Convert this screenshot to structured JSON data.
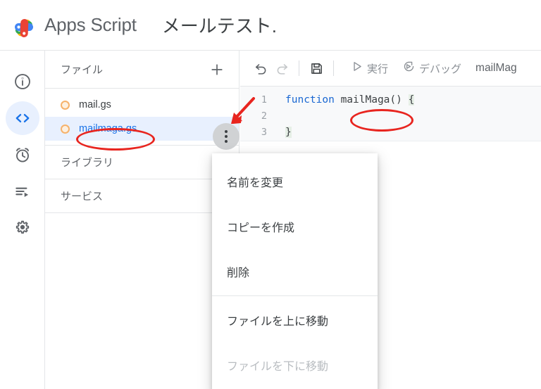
{
  "header": {
    "logo_icon": "apps-script-logo",
    "brand": "Apps Script",
    "project_title": "メールテスト.",
    "logo_colors": {
      "yellow": "#fbbc04",
      "green": "#34a853",
      "blue": "#4285f4",
      "red": "#ea4335"
    }
  },
  "rail": {
    "items": [
      {
        "icon": "info-circle-icon",
        "name": "overview",
        "active": false
      },
      {
        "icon": "code-brackets-icon",
        "name": "editor",
        "active": true
      },
      {
        "icon": "alarm-clock-icon",
        "name": "triggers",
        "active": false
      },
      {
        "icon": "executions-list-icon",
        "name": "executions",
        "active": false
      },
      {
        "icon": "gear-icon",
        "name": "project-settings",
        "active": false
      }
    ],
    "active_bg": "#e8f0fe",
    "active_color": "#1a73e8"
  },
  "file_panel": {
    "header_label": "ファイル",
    "add_icon": "plus-icon",
    "files": [
      {
        "name": "mail.gs",
        "selected": false,
        "dot_color": "#f6b26b"
      },
      {
        "name": "mailmaga.gs",
        "selected": true,
        "dot_color": "#f6b26b"
      }
    ],
    "sections": [
      {
        "label": "ライブラリ"
      },
      {
        "label": "サービス"
      }
    ],
    "more_button_icon": "more-vert-icon",
    "selected_row_bg": "#e8f0fe",
    "selected_text_color": "#1a73e8"
  },
  "toolbar": {
    "undo_icon": "undo-icon",
    "redo_icon": "redo-icon",
    "save_icon": "save-disk-icon",
    "run_icon": "play-triangle-icon",
    "run_label": "実行",
    "debug_icon": "debug-icon",
    "debug_label": "デバッグ",
    "function_name": "mailMag"
  },
  "code": {
    "lines": [
      {
        "number": "1",
        "keyword": "function",
        "space": " ",
        "fname": "mailMaga",
        "parens": "()",
        "brace": "{"
      },
      {
        "number": "2",
        "text": ""
      },
      {
        "number": "3",
        "brace": "}"
      }
    ]
  },
  "context_menu": {
    "items": [
      {
        "label": "名前を変更",
        "disabled": false
      },
      {
        "label": "コピーを作成",
        "disabled": false
      },
      {
        "label": "削除",
        "disabled": false
      },
      {
        "label": "ファイルを上に移動",
        "disabled": false
      },
      {
        "label": "ファイルを下に移動",
        "disabled": true
      }
    ]
  },
  "annotations": {
    "color": "#e8251f",
    "ellipse_file": "mailmaga.gs",
    "ellipse_code": "mailMaga",
    "arrow_target": "more-vert-icon"
  }
}
